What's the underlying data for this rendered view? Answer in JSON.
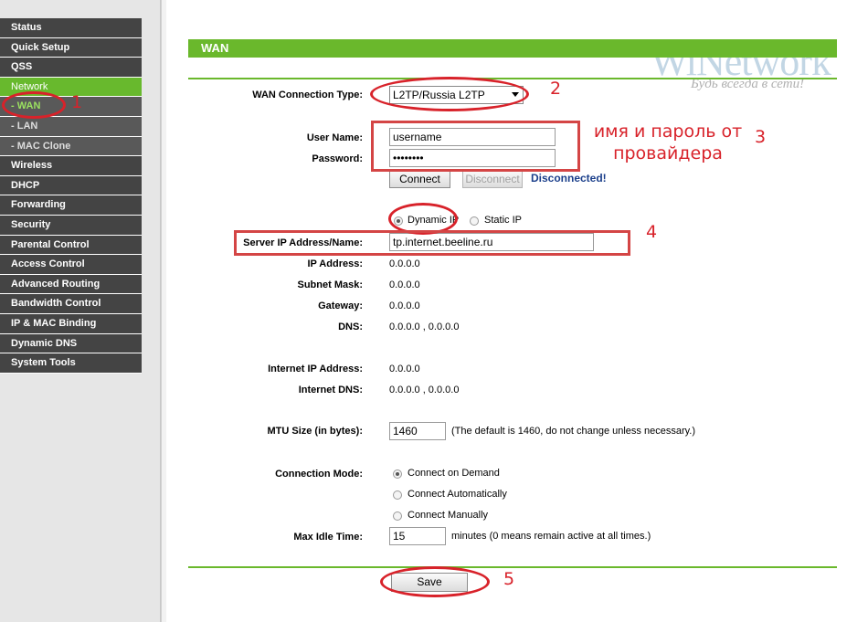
{
  "sidebar": {
    "items": [
      {
        "label": "Status"
      },
      {
        "label": "Quick Setup"
      },
      {
        "label": "QSS"
      },
      {
        "label": "Network"
      },
      {
        "label": "- WAN"
      },
      {
        "label": "- LAN"
      },
      {
        "label": "- MAC Clone"
      },
      {
        "label": "Wireless"
      },
      {
        "label": "DHCP"
      },
      {
        "label": "Forwarding"
      },
      {
        "label": "Security"
      },
      {
        "label": "Parental Control"
      },
      {
        "label": "Access Control"
      },
      {
        "label": "Advanced Routing"
      },
      {
        "label": "Bandwidth Control"
      },
      {
        "label": "IP & MAC Binding"
      },
      {
        "label": "Dynamic DNS"
      },
      {
        "label": "System Tools"
      }
    ]
  },
  "header": {
    "title": "WAN",
    "watermark_title": "WiNetwork",
    "watermark_sub": "Будь всегда в сети!"
  },
  "form": {
    "conn_type_label": "WAN Connection Type:",
    "conn_type_value": "L2TP/Russia L2TP",
    "username_label": "User Name:",
    "username_value": "username",
    "password_label": "Password:",
    "password_value": "••••••••",
    "connect_label": "Connect",
    "disconnect_label": "Disconnect",
    "status_text": "Disconnected!",
    "dynamic_ip_label": "Dynamic IP",
    "static_ip_label": "Static IP",
    "server_label": "Server IP Address/Name:",
    "server_value": "tp.internet.beeline.ru",
    "ip_label": "IP Address:",
    "ip_value": "0.0.0.0",
    "mask_label": "Subnet Mask:",
    "mask_value": "0.0.0.0",
    "gateway_label": "Gateway:",
    "gateway_value": "0.0.0.0",
    "dns_label": "DNS:",
    "dns_value": "0.0.0.0 , 0.0.0.0",
    "inet_ip_label": "Internet IP Address:",
    "inet_ip_value": "0.0.0.0",
    "inet_dns_label": "Internet DNS:",
    "inet_dns_value": "0.0.0.0 , 0.0.0.0",
    "mtu_label": "MTU Size (in bytes):",
    "mtu_value": "1460",
    "mtu_hint": "(The default is 1460, do not change unless necessary.)",
    "mode_label": "Connection Mode:",
    "mode_demand": "Connect on Demand",
    "mode_auto": "Connect Automatically",
    "mode_manual": "Connect Manually",
    "idle_label": "Max Idle Time:",
    "idle_value": "15",
    "idle_hint": "minutes (0 means remain active at all times.)",
    "save_label": "Save"
  },
  "annotations": {
    "n1": "1",
    "n2": "2",
    "n3": "3",
    "n4": "4",
    "n5": "5",
    "note": "имя и пароль от провайдера"
  },
  "colors": {
    "accent_green": "#6ab82c",
    "sidebar_dark": "#444444",
    "annotation_red": "#d8222a",
    "status_blue": "#1b3f8b"
  }
}
